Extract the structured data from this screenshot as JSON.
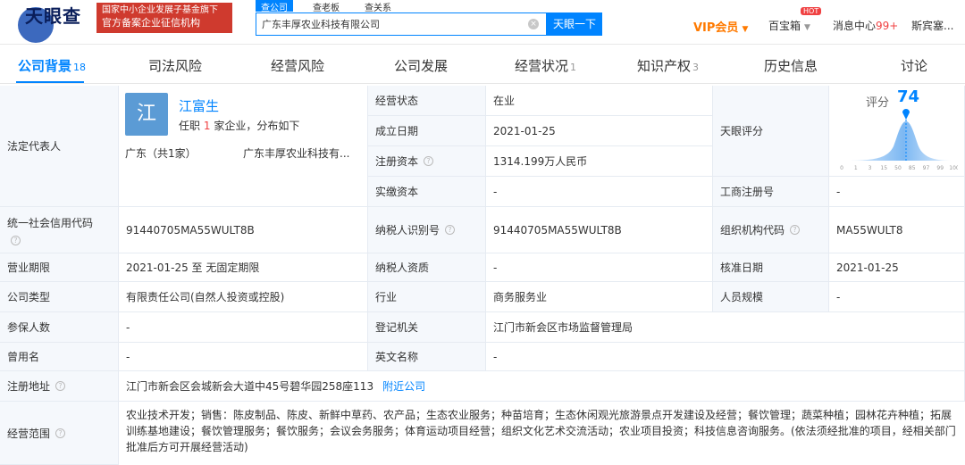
{
  "header": {
    "logo_text": "天眼查",
    "banner_line1": "国家中小企业发展子基金旗下",
    "banner_line2": "官方备案企业征信机构",
    "search_tabs": [
      "查公司",
      "查老板",
      "查关系"
    ],
    "search_value": "广东丰厚农业科技有限公司",
    "search_button": "天眼一下",
    "vip_label": "VIP会员",
    "baobox_label": "百宝箱",
    "hot_badge": "HOT",
    "msg_label": "消息中心",
    "msg_count": "99+",
    "user_label": "斯宾塞..."
  },
  "nav": [
    {
      "label": "公司背景",
      "count": "18"
    },
    {
      "label": "司法风险",
      "count": ""
    },
    {
      "label": "经营风险",
      "count": ""
    },
    {
      "label": "公司发展",
      "count": ""
    },
    {
      "label": "经营状况",
      "count": "1"
    },
    {
      "label": "知识产权",
      "count": "3"
    },
    {
      "label": "历史信息",
      "count": ""
    },
    {
      "label": "讨论",
      "count": ""
    }
  ],
  "rep": {
    "label": "法定代表人",
    "avatar_char": "江",
    "name": "江富生",
    "sub_prefix": "任职",
    "sub_count": "1",
    "sub_suffix": "家企业，分布如下",
    "location": "广东（共1家）",
    "company": "广东丰厚农业科技有..."
  },
  "score": {
    "label": "天眼评分",
    "prefix": "评分",
    "value": "74",
    "axis_ticks": [
      "0",
      "1",
      "3",
      "15",
      "50",
      "85",
      "97",
      "99",
      "100"
    ]
  },
  "rows": {
    "status_label": "经营状态",
    "status_value": "在业",
    "founded_label": "成立日期",
    "founded_value": "2021-01-25",
    "capital_label": "注册资本",
    "capital_value": "1314.199万人民币",
    "paid_label": "实缴资本",
    "paid_value": "-",
    "bizreg_label": "工商注册号",
    "bizreg_value": "-",
    "credit_label": "统一社会信用代码",
    "credit_value": "91440705MA55WULT8B",
    "taxid_label": "纳税人识别号",
    "taxid_value": "91440705MA55WULT8B",
    "org_label": "组织机构代码",
    "org_value": "MA55WULT8",
    "term_label": "营业期限",
    "term_value": "2021-01-25 至 无固定期限",
    "taxq_label": "纳税人资质",
    "taxq_value": "-",
    "approve_label": "核准日期",
    "approve_value": "2021-01-25",
    "type_label": "公司类型",
    "type_value": "有限责任公司(自然人投资或控股)",
    "industry_label": "行业",
    "industry_value": "商务服务业",
    "staff_label": "人员规模",
    "staff_value": "-",
    "insured_label": "参保人数",
    "insured_value": "-",
    "authority_label": "登记机关",
    "authority_value": "江门市新会区市场监督管理局",
    "former_label": "曾用名",
    "former_value": "-",
    "english_label": "英文名称",
    "english_value": "-",
    "address_label": "注册地址",
    "address_value": "江门市新会区会城新会大道中45号碧华园258座113",
    "address_link": "附近公司",
    "scope_label": "经营范围",
    "scope_value": "农业技术开发；销售：陈皮制品、陈皮、新鲜中草药、农产品；生态农业服务；种苗培育；生态休闲观光旅游景点开发建设及经营；餐饮管理；蔬菜种植；园林花卉种植；拓展训练基地建设；餐饮管理服务；餐饮服务；会议会务服务；体育运动项目经营；组织文化艺术交流活动；农业项目投资；科技信息咨询服务。(依法须经批准的项目，经相关部门批准后方可开展经营活动)"
  },
  "colors": {
    "accent": "#0084ff",
    "label_bg": "#f5f8fc",
    "banner": "#cf3a2e",
    "vip": "#ff7a00",
    "badge": "#f04142"
  }
}
